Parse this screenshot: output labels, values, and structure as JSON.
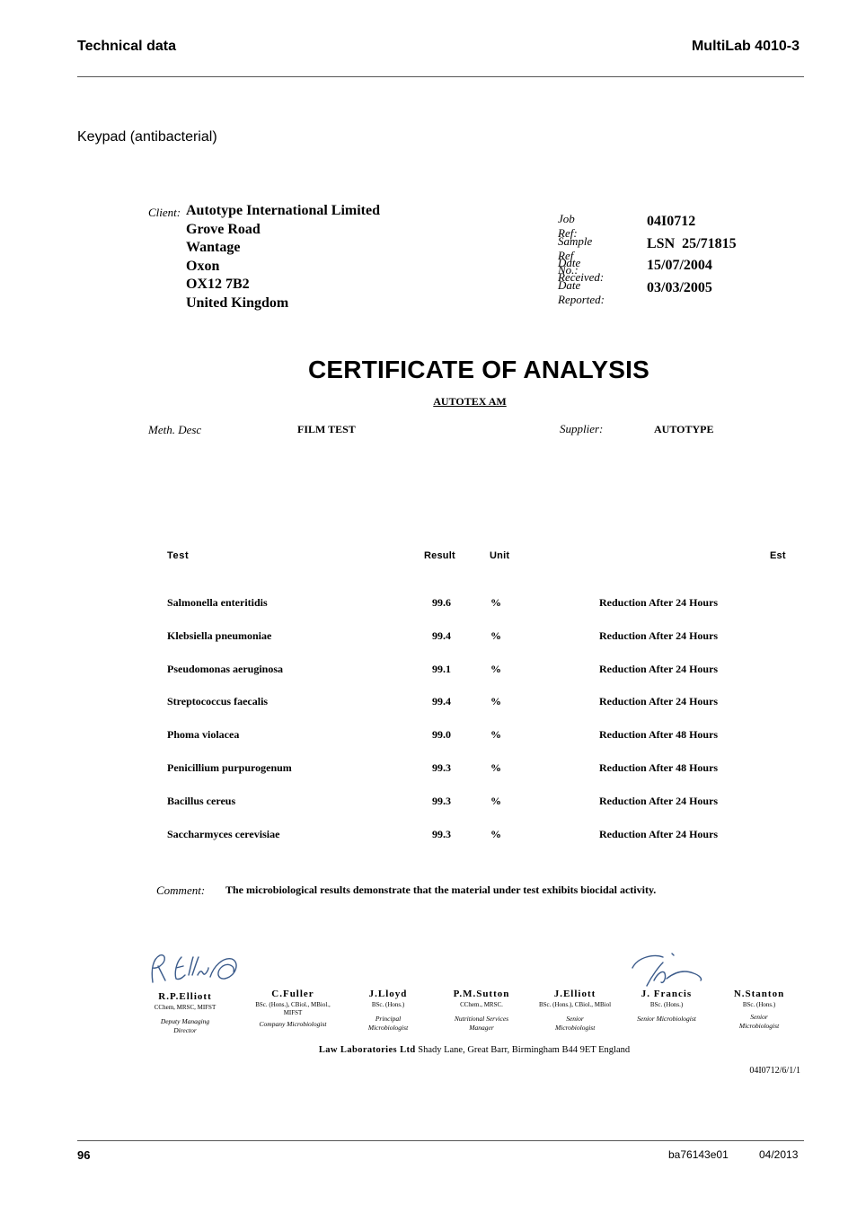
{
  "header": {
    "section": "Technical data",
    "product": "MultiLab 4010-3"
  },
  "section_title": "Keypad (antibacterial)",
  "client": {
    "label": "Client:",
    "lines": [
      "Autotype International Limited",
      "Grove Road",
      "Wantage",
      "Oxon",
      "OX12 7B2",
      "United Kingdom"
    ]
  },
  "refs": [
    {
      "label": "Job Ref:",
      "value": "04I0712"
    },
    {
      "label": "Sample Ref No.:",
      "value": "LSN  25/71815"
    },
    {
      "label": "Date Received:",
      "value": "15/07/2004"
    },
    {
      "label": "Date Reported:",
      "value": "03/03/2005"
    }
  ],
  "certificate": {
    "title": "CERTIFICATE OF ANALYSIS",
    "product": "AUTOTEX AM",
    "method_label": "Meth. Desc",
    "method_value": "FILM TEST",
    "supplier_label": "Supplier:",
    "supplier_value": "AUTOTYPE"
  },
  "table": {
    "headers": {
      "test": "Test",
      "result": "Result",
      "unit": "Unit",
      "est": "Est"
    },
    "rows": [
      {
        "test": "Salmonella enteritidis",
        "result": "99.6",
        "unit": "%",
        "est": "Reduction After 24 Hours"
      },
      {
        "test": "Klebsiella pneumoniae",
        "result": "99.4",
        "unit": "%",
        "est": "Reduction After 24 Hours"
      },
      {
        "test": "Pseudomonas aeruginosa",
        "result": "99.1",
        "unit": "%",
        "est": "Reduction After 24 Hours"
      },
      {
        "test": "Streptococcus faecalis",
        "result": "99.4",
        "unit": "%",
        "est": "Reduction After 24 Hours"
      },
      {
        "test": "Phoma violacea",
        "result": "99.0",
        "unit": "%",
        "est": "Reduction After 48 Hours"
      },
      {
        "test": "Penicillium purpurogenum",
        "result": "99.3",
        "unit": "%",
        "est": "Reduction After 48 Hours"
      },
      {
        "test": "Bacillus cereus",
        "result": "99.3",
        "unit": "%",
        "est": "Reduction After 24 Hours"
      },
      {
        "test": "Saccharmyces cerevisiae",
        "result": "99.3",
        "unit": "%",
        "est": "Reduction After 24 Hours"
      }
    ]
  },
  "comment": {
    "label": "Comment:",
    "text": "The microbiological results demonstrate that the material under test exhibits biocidal activity."
  },
  "signatories": [
    {
      "name": "R.P.Elliott",
      "qual": "CChem, MRSC, MIFST",
      "role": "Deputy Managing Director"
    },
    {
      "name": "C.Fuller",
      "qual": "BSc. (Hons.), CBiol., MBiol., MIFST",
      "role": "Company Microbiologist"
    },
    {
      "name": "J.Lloyd",
      "qual": "BSc. (Hons.)",
      "role": "Principal Microbiologist"
    },
    {
      "name": "P.M.Sutton",
      "qual": "CChem., MRSC.",
      "role": "Nutritional Services Manager"
    },
    {
      "name": "J.Elliott",
      "qual": "BSc. (Hons.), CBiol., MBiol",
      "role": "Senior Microbiologist"
    },
    {
      "name": "J. Francis",
      "qual": "BSc. (Hons.)",
      "role": "Senior Microbiologist"
    },
    {
      "name": "N.Stanton",
      "qual": "BSc. (Hons.)",
      "role": "Senior Microbiologist"
    }
  ],
  "signature_ink_color": "#3a5a8a",
  "laboratory": {
    "name": "Law Laboratories Ltd",
    "address": "Shady Lane, Great Barr, Birmingham B44 9ET England"
  },
  "document_ref": "04I0712/6/1/1",
  "footer": {
    "page": "96",
    "code": "ba76143e01",
    "date": "04/2013"
  }
}
